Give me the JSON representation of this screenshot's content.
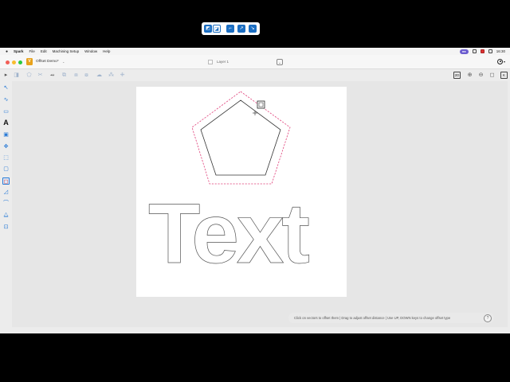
{
  "menubar": {
    "apple": "",
    "app": "Spark",
    "items": [
      "File",
      "Edit",
      "Machining Setup",
      "Window",
      "Help"
    ],
    "time": "16:30",
    "pill": "●●"
  },
  "titlebar": {
    "doc_icon": "V",
    "doc_name": "Offset Demo*",
    "doc_caret": "⌄",
    "layer_name": "Layer 1",
    "layer_dropdown": "⌄"
  },
  "toolbar": {
    "view_2d": "2D",
    "zoom_in": "⊕",
    "zoom_out": "⊖",
    "fit": "◻"
  },
  "canvas": {
    "text_shape": "Text"
  },
  "status": {
    "hint": "Click on vectors to offset them | Drag to adjust offset distance | Use UP, DOWN keys to change offset type",
    "help": "?"
  },
  "colors": {
    "accent": "#1b6ec2",
    "offset_preview": "#e0407a",
    "vector": "#555555"
  }
}
